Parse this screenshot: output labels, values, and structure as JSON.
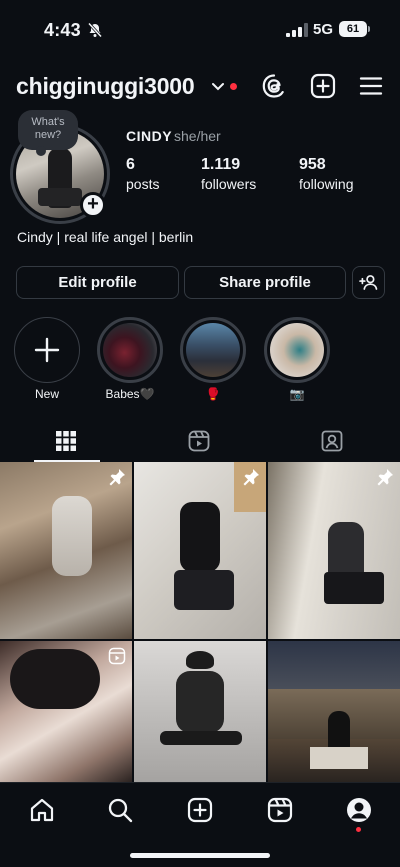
{
  "status": {
    "time": "4:43",
    "network": "5G",
    "battery": "61"
  },
  "header": {
    "username": "chigginuggi3000"
  },
  "profile": {
    "note": "What's new?",
    "display_name": "CINDY",
    "pronouns": "she/her",
    "stats": [
      {
        "num": "6",
        "label": "posts"
      },
      {
        "num": "1.119",
        "label": "followers"
      },
      {
        "num": "958",
        "label": "following"
      }
    ],
    "bio": "Cindy | real life angel | berlin"
  },
  "buttons": {
    "edit": "Edit profile",
    "share": "Share profile"
  },
  "highlights": [
    {
      "label": "New"
    },
    {
      "label": "Babes🖤"
    },
    {
      "label": "🥊"
    },
    {
      "label": "📷"
    }
  ],
  "colors": {
    "background": "#0b0e13",
    "accent": "#ff3040",
    "border": "#343a42"
  }
}
